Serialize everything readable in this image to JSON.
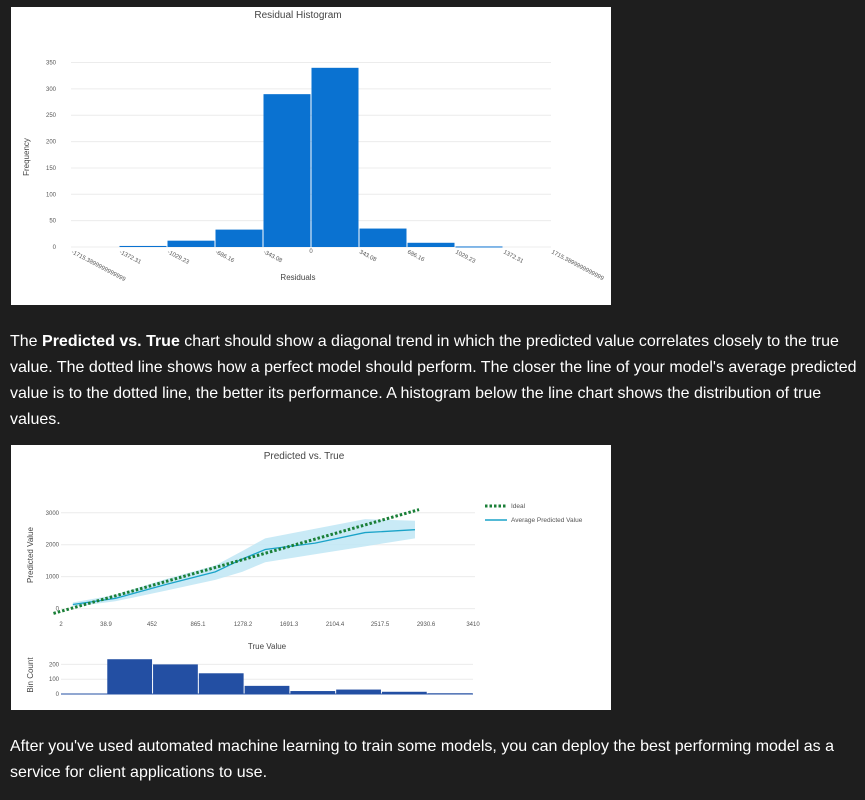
{
  "histogram_chart": {
    "chart_data": {
      "type": "bar",
      "title": "Residual Histogram",
      "xlabel": "Residuals",
      "ylabel": "Frequency",
      "ylim": [
        0,
        370
      ],
      "y_ticks": [
        "0",
        "50",
        "100",
        "150",
        "200",
        "250",
        "300",
        "350"
      ],
      "x_ticks": [
        "-1715.3899999999999",
        "-1372.31",
        "-1029.23",
        "-686.16",
        "-343.08",
        "0",
        "343.08",
        "686.16",
        "1029.23",
        "1372.31",
        "1715.3899999999999"
      ],
      "bin_edges": [
        -1715.39,
        -1372.31,
        -1029.23,
        -686.16,
        -343.08,
        0,
        343.08,
        686.16,
        1029.23,
        1372.31,
        1715.39
      ],
      "values": [
        0,
        2,
        12,
        33,
        290,
        340,
        35,
        8,
        1,
        0
      ],
      "bar_color": "#0a72d1",
      "grid": true
    }
  },
  "paragraph1": {
    "pre": "The ",
    "bold": "Predicted vs. True",
    "post": " chart should show a diagonal trend in which the predicted value correlates closely to the true value. The dotted line shows how a perfect model should perform. The closer the line of your model's average predicted value is to the dotted line, the better its performance. A histogram below the line chart shows the distribution of true values."
  },
  "pvt_chart": {
    "chart_data": {
      "type": "line",
      "title": "Predicted vs. True",
      "xlabel": "True Value",
      "ylabel": "Predicted Value",
      "ylim": [
        -200,
        3400
      ],
      "xlim": [
        2,
        3410
      ],
      "x_ticks": [
        "2",
        "38.9",
        "452",
        "865.1",
        "1278.2",
        "1691.3",
        "2104.4",
        "2517.5",
        "2930.6",
        "3410"
      ],
      "y_ticks": [
        "0",
        "1000",
        "2000",
        "3000"
      ],
      "x": [
        100,
        452,
        865,
        1278,
        1691,
        2104,
        2517,
        2930
      ],
      "series": [
        {
          "name": "Ideal",
          "color": "#1a7f37",
          "style": "dotted",
          "x": [
            38.9,
            2930.6
          ],
          "values": [
            -150,
            3100
          ]
        },
        {
          "name": "Average Predicted Value",
          "color": "#1aa3c8",
          "style": "solid",
          "values": [
            130,
            320,
            750,
            1150,
            1550,
            1850,
            2050,
            2380,
            2470
          ],
          "x_values": [
            100,
            452,
            865,
            1278,
            1500,
            1691,
            2104,
            2517,
            2930
          ],
          "band_low": [
            60,
            230,
            560,
            900,
            1150,
            1450,
            1700,
            1950,
            2200
          ],
          "band_high": [
            190,
            430,
            920,
            1350,
            1800,
            2200,
            2500,
            2800,
            2750
          ]
        }
      ],
      "legend": "top-right",
      "grid": true
    },
    "bin_chart": {
      "ylabel": "Bin Count",
      "y_ticks": [
        "0",
        "100",
        "200"
      ],
      "ylim": [
        0,
        250
      ],
      "values": [
        0,
        235,
        200,
        140,
        55,
        20,
        30,
        15,
        5
      ],
      "bar_color": "#234fa3"
    }
  },
  "paragraph2": {
    "text": "After you've used automated machine learning to train some models, you can deploy the best performing model as a service for client applications to use."
  }
}
